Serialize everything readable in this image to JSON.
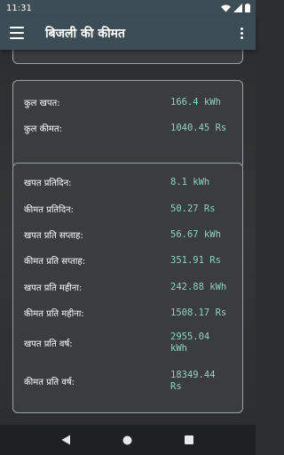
{
  "status_bar": {
    "time": "11:31",
    "icons": [
      "wifi-icon",
      "signal-icon",
      "battery-icon"
    ]
  },
  "app_bar": {
    "title": "बिजली की कीमत",
    "menu_icon": "hamburger-menu-icon",
    "overflow_icon": "more-vert-icon"
  },
  "totals": [
    {
      "label": "कुल खपत:",
      "value": "166.4 kWh"
    },
    {
      "label": "कुल कीमत:",
      "value": "1040.45 Rs"
    }
  ],
  "stats": [
    {
      "label": "खपत प्रतिदिन:",
      "value": "8.1 kWh"
    },
    {
      "label": "कीमत प्रतिदिन:",
      "value": "50.27 Rs"
    },
    {
      "label": "खपत प्रति सप्ताह:",
      "value": "56.67 kWh"
    },
    {
      "label": "कीमत प्रति सप्ताह:",
      "value": "351.91 Rs"
    },
    {
      "label": "खपत प्रति महीना:",
      "value": "242.88 kWh"
    },
    {
      "label": "कीमत प्रति महीना:",
      "value": "1508.17 Rs"
    },
    {
      "label": "खपत प्रति वर्ष:",
      "value": "2955.04 kWh"
    },
    {
      "label": "कीमत प्रति वर्ष:",
      "value": "18349.44 Rs"
    }
  ],
  "nav_bar": {
    "icons": [
      "back-icon",
      "home-icon",
      "recents-icon"
    ]
  },
  "colors": {
    "app_bar": "#3c4d55",
    "value_text": "#8fd3c3",
    "card_border": "#9aa3a8",
    "background": "#2b2d2e"
  }
}
